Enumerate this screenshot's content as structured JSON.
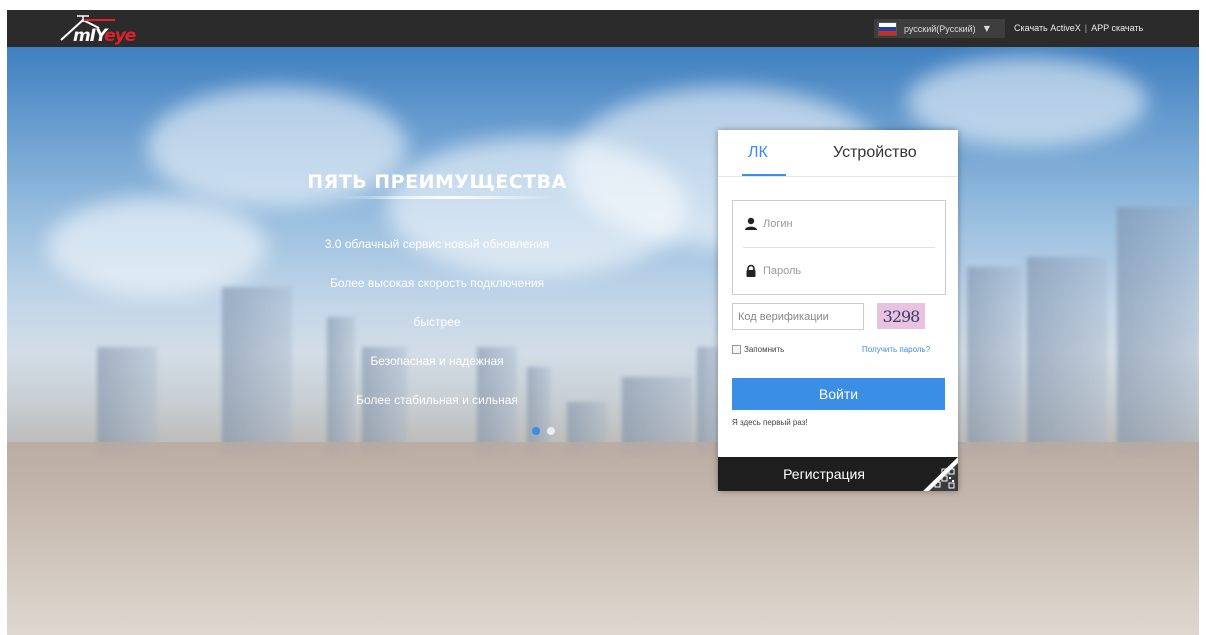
{
  "header": {
    "logo_parts": [
      "m",
      "IY",
      "e",
      "y",
      "e"
    ],
    "language": "русский(Русский)",
    "download_activex": "Скачать ActiveX",
    "separator": "|",
    "download_app": "APP скачать"
  },
  "advantages": {
    "title": "ПЯТЬ ПРЕИМУЩЕСТВА",
    "items": [
      "3.0 облачный сервис новый обновления",
      "Более высокая скорость подключения",
      "быстрее",
      "Безопасная и надежная",
      "Более стабильная и сильная"
    ]
  },
  "login": {
    "tabs": [
      "ЛК",
      "Устройство"
    ],
    "active_tab": "ЛК",
    "username_placeholder": "Логин",
    "password_placeholder": "Пароль",
    "code_placeholder": "Код верификации",
    "captcha": "3298",
    "remember": "Запомнить",
    "forgot": "Получить пароль?",
    "submit": "Войти",
    "first_time": "Я здесь первый раз!",
    "register": "Регистрация"
  },
  "colors": {
    "accent": "#3a8ee6",
    "topbar": "#2b2b2b",
    "logo_red": "#e0202a"
  }
}
